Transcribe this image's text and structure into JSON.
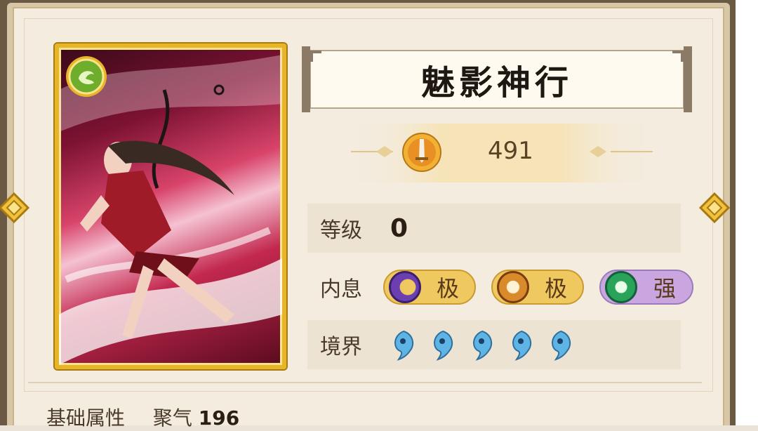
{
  "hero": {
    "name": "魅影神行",
    "power": "491",
    "level_label": "等级",
    "level_value": "0",
    "inner_label": "内息",
    "inner_items": [
      {
        "text": "极",
        "icon": "moon-orb-icon",
        "color": "#6b3fb0"
      },
      {
        "text": "极",
        "icon": "sun-orb-icon",
        "color": "#d98a2b"
      },
      {
        "text": "强",
        "icon": "jade-orb-icon",
        "color": "#2aa35a"
      }
    ],
    "realm_label": "境界",
    "realm_count": 5,
    "realm_icon": "spirit-drop-icon"
  },
  "bottom": {
    "section_label": "基础属性",
    "stat_label": "聚气",
    "stat_value": "196"
  },
  "colors": {
    "card_border": "#e7b52a",
    "pill_gold": "#f0c860",
    "pill_purple": "#c9a6e0"
  }
}
